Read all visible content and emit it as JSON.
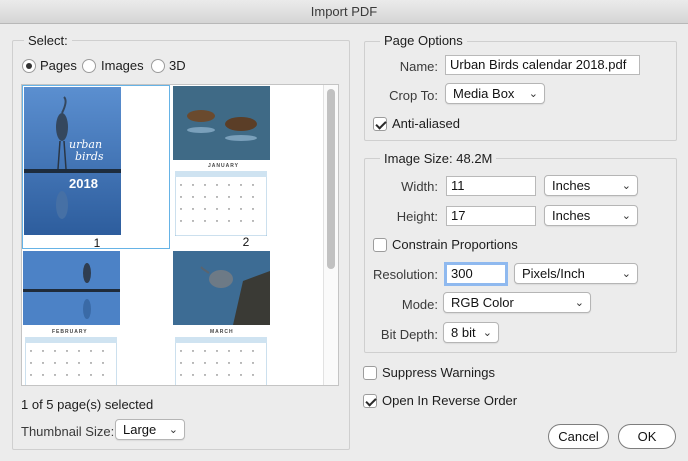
{
  "window": {
    "title": "Import PDF"
  },
  "select": {
    "legend": "Select:",
    "options": [
      {
        "label": "Pages",
        "selected": true
      },
      {
        "label": "Images",
        "selected": false
      },
      {
        "label": "3D",
        "selected": false
      }
    ],
    "thumbnails": [
      {
        "page": "1",
        "month": "",
        "cover_text_1": "urban",
        "cover_text_2": "birds",
        "year": "2018",
        "selected": true
      },
      {
        "page": "2",
        "month": "JANUARY",
        "selected": false
      },
      {
        "page": "",
        "month": "FEBRUARY",
        "selected": false
      },
      {
        "page": "",
        "month": "MARCH",
        "selected": false
      }
    ],
    "status": "1 of 5 page(s) selected",
    "thumb_size_label": "Thumbnail Size:",
    "thumb_size_value": "Large"
  },
  "page_options": {
    "legend": "Page Options",
    "name_label": "Name:",
    "name_value": "Urban Birds calendar 2018.pdf",
    "crop_label": "Crop To:",
    "crop_value": "Media Box",
    "anti_aliased_label": "Anti-aliased",
    "anti_aliased": true
  },
  "image_size": {
    "legend": "Image Size: 48.2M",
    "width_label": "Width:",
    "width_value": "11",
    "width_unit": "Inches",
    "height_label": "Height:",
    "height_value": "17",
    "height_unit": "Inches",
    "constrain_label": "Constrain Proportions",
    "constrain": false,
    "resolution_label": "Resolution:",
    "resolution_value": "300",
    "resolution_unit": "Pixels/Inch",
    "mode_label": "Mode:",
    "mode_value": "RGB Color",
    "bitdepth_label": "Bit Depth:",
    "bitdepth_value": "8 bit"
  },
  "options": {
    "suppress_label": "Suppress Warnings",
    "suppress": false,
    "reverse_label": "Open In Reverse Order",
    "reverse": true
  },
  "buttons": {
    "cancel": "Cancel",
    "ok": "OK"
  },
  "colors": {
    "accent": "#5a9de6",
    "sky": "#3f74b8"
  }
}
